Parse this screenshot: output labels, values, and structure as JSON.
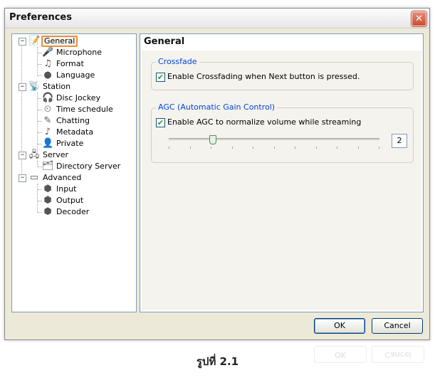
{
  "window": {
    "title": "Preferences",
    "close_glyph": "✕"
  },
  "tree": {
    "items": [
      {
        "label": "General",
        "icon": "general-icon",
        "selected": true
      },
      {
        "label": "Microphone",
        "icon": "microphone-icon"
      },
      {
        "label": "Format",
        "icon": "format-icon"
      },
      {
        "label": "Language",
        "icon": "language-icon"
      },
      {
        "label": "Station",
        "icon": "station-icon"
      },
      {
        "label": "Disc Jockey",
        "icon": "disc-jockey-icon"
      },
      {
        "label": "Time schedule",
        "icon": "time-schedule-icon"
      },
      {
        "label": "Chatting",
        "icon": "chatting-icon"
      },
      {
        "label": "Metadata",
        "icon": "metadata-icon"
      },
      {
        "label": "Private",
        "icon": "private-icon"
      },
      {
        "label": "Server",
        "icon": "server-icon"
      },
      {
        "label": "Directory Server",
        "icon": "directory-server-icon"
      },
      {
        "label": "Advanced",
        "icon": "advanced-icon"
      },
      {
        "label": "Input",
        "icon": "input-icon"
      },
      {
        "label": "Output",
        "icon": "output-icon"
      },
      {
        "label": "Decoder",
        "icon": "decoder-icon"
      }
    ]
  },
  "panel": {
    "title": "General",
    "crossfade": {
      "legend": "Crossfade",
      "checkbox_label": "Enable Crossfading when Next button is pressed.",
      "checked": true
    },
    "agc": {
      "legend": "AGC (Automatic Gain Control)",
      "checkbox_label": "Enable AGC to normalize volume while streaming",
      "checked": true,
      "value": "2",
      "slider_level": 0.2
    }
  },
  "buttons": {
    "ok": "OK",
    "cancel": "Cancel"
  },
  "caption": "รูปที่ 2.1",
  "colors": {
    "legend": "#0046d5",
    "selection_border": "#e8903c",
    "check": "#21a121"
  }
}
